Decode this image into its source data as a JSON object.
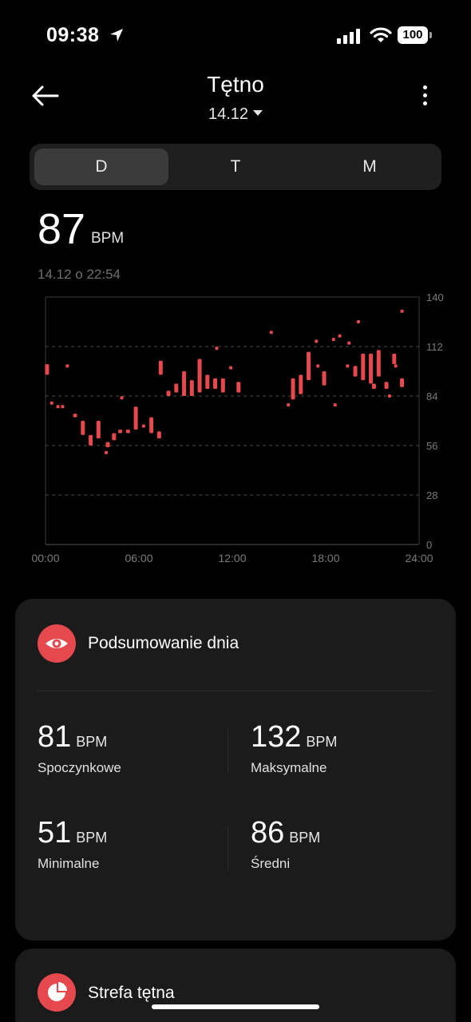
{
  "status_bar": {
    "time": "09:38",
    "battery": "100"
  },
  "header": {
    "title": "Tętno",
    "date": "14.12"
  },
  "tabs": [
    {
      "label": "D",
      "active": true
    },
    {
      "label": "T",
      "active": false
    },
    {
      "label": "M",
      "active": false
    }
  ],
  "current": {
    "value": "87",
    "unit": "BPM",
    "timestamp": "14.12 o 22:54"
  },
  "chart_data": {
    "type": "range_bar",
    "x_ticks": [
      "00:00",
      "06:00",
      "12:00",
      "18:00",
      "24:00"
    ],
    "y_ticks": [
      0,
      28,
      56,
      84,
      112,
      140
    ],
    "ylim": [
      0,
      140
    ],
    "xlim_hours": [
      0,
      24
    ],
    "color": "#e5484d",
    "bars": [
      [
        0.1,
        96,
        102
      ],
      [
        0.4,
        80,
        80
      ],
      [
        0.8,
        78,
        78
      ],
      [
        1.1,
        78,
        78
      ],
      [
        1.4,
        101,
        101
      ],
      [
        1.9,
        72,
        74
      ],
      [
        2.4,
        62,
        70
      ],
      [
        2.9,
        56,
        62
      ],
      [
        3.4,
        60,
        70
      ],
      [
        3.9,
        52,
        52
      ],
      [
        4.0,
        55,
        58
      ],
      [
        4.4,
        59,
        63
      ],
      [
        4.9,
        83,
        83
      ],
      [
        4.8,
        63,
        65
      ],
      [
        5.3,
        63,
        65
      ],
      [
        5.8,
        65,
        78
      ],
      [
        6.3,
        66,
        67
      ],
      [
        6.8,
        63,
        72
      ],
      [
        7.3,
        60,
        64
      ],
      [
        7.4,
        96,
        104
      ],
      [
        7.9,
        84,
        87
      ],
      [
        8.4,
        86,
        91
      ],
      [
        8.9,
        84,
        98
      ],
      [
        9.4,
        84,
        93
      ],
      [
        9.9,
        86,
        105
      ],
      [
        10.4,
        88,
        96
      ],
      [
        10.9,
        88,
        94
      ],
      [
        11.0,
        111,
        111
      ],
      [
        11.4,
        86,
        94
      ],
      [
        11.9,
        100,
        100
      ],
      [
        12.4,
        86,
        92
      ],
      [
        14.5,
        120,
        120
      ],
      [
        15.6,
        79,
        79
      ],
      [
        15.9,
        82,
        94
      ],
      [
        16.4,
        85,
        96
      ],
      [
        16.9,
        93,
        109
      ],
      [
        17.4,
        115,
        115
      ],
      [
        17.5,
        101,
        101
      ],
      [
        17.9,
        90,
        98
      ],
      [
        18.5,
        116,
        116
      ],
      [
        18.6,
        79,
        79
      ],
      [
        18.9,
        118,
        118
      ],
      [
        19.4,
        101,
        101
      ],
      [
        19.5,
        114,
        114
      ],
      [
        19.9,
        95,
        101
      ],
      [
        20.1,
        126,
        126
      ],
      [
        20.4,
        93,
        108
      ],
      [
        20.9,
        91,
        108
      ],
      [
        21.1,
        88,
        91
      ],
      [
        21.4,
        95,
        110
      ],
      [
        21.9,
        88,
        92
      ],
      [
        22.1,
        84,
        84
      ],
      [
        22.4,
        102,
        108
      ],
      [
        22.5,
        101,
        101
      ],
      [
        22.9,
        89,
        94
      ],
      [
        22.9,
        132,
        132
      ]
    ]
  },
  "summary": {
    "title": "Podsumowanie dnia",
    "stats": [
      {
        "value": "81",
        "unit": "BPM",
        "label": "Spoczynkowe"
      },
      {
        "value": "132",
        "unit": "BPM",
        "label": "Maksymalne"
      },
      {
        "value": "51",
        "unit": "BPM",
        "label": "Minimalne"
      },
      {
        "value": "86",
        "unit": "BPM",
        "label": "Średni"
      }
    ]
  },
  "zones": {
    "title": "Strefa tętna"
  }
}
